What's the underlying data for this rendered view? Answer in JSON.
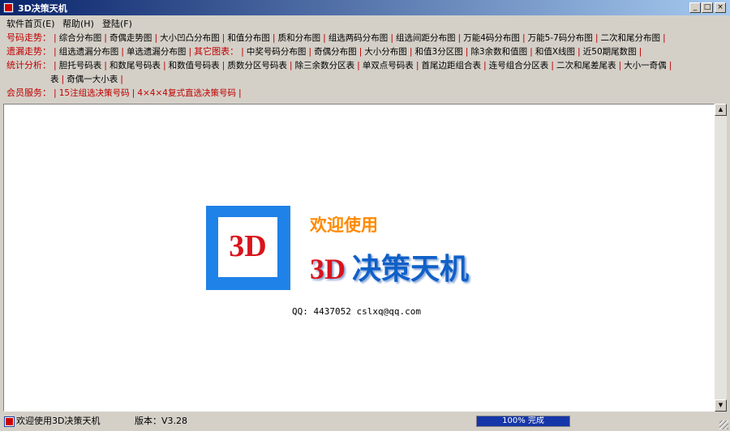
{
  "window": {
    "title": "3D决策天机",
    "min": "_",
    "max": "□",
    "close": "×"
  },
  "menu": [
    "软件首页(E)",
    "帮助(H)",
    "登陆(F)"
  ],
  "nav": [
    {
      "category": "号码走势：",
      "links": [
        "综合分布图",
        "奇偶走势图",
        "大小凹凸分布图",
        "和值分布图",
        "质和分布图",
        "组选两码分布图",
        "组选间距分布图",
        "万能4码分布图",
        "万能5-7码分布图",
        "二次和尾分布图"
      ]
    },
    {
      "category": "遗漏走势：",
      "links": [
        "组选遗漏分布图",
        "单选遗漏分布图"
      ],
      "category2": "其它图表：",
      "links2": [
        "中奖号码分布图",
        "奇偶分布图",
        "大小分布图",
        "和值3分区图",
        "除3余数和值图",
        "和值X线图",
        "近50期尾数图"
      ]
    },
    {
      "category": "统计分析：",
      "links": [
        "胆托号码表",
        "和数尾号码表",
        "和数值号码表",
        "质数分区号码表",
        "除三余数分区表",
        "单双点号码表",
        "首尾边距组合表",
        "连号组合分区表",
        "二次和尾差尾表",
        "大小一奇偶"
      ],
      "wrap": [
        "表",
        "奇偶一大小表"
      ]
    },
    {
      "category": "会员服务：",
      "links": [
        "15注组选决策号码",
        "4×4×4复式直选决策号码"
      ]
    }
  ],
  "main": {
    "logo_text": "3D",
    "welcome": "欢迎使用",
    "brand_3d": "3D",
    "brand_cn": "决策天机",
    "contact": "QQ: 4437052 cslxq@qq.com"
  },
  "status": {
    "message": "欢迎使用3D决策天机",
    "version": "版本：V3.28",
    "progress_text": "100% 完成",
    "progress": 1.0
  },
  "colors": {
    "category": "#c00000",
    "brand_red": "#d8141c",
    "brand_blue": "#1060c8",
    "logo_blue": "#1f82e8",
    "welcome": "#ff8a00"
  },
  "icons": {
    "minimize": "minimize-icon",
    "maximize": "maximize-icon",
    "close": "close-icon",
    "scroll_up": "scroll-up-icon",
    "scroll_down": "scroll-down-icon"
  }
}
